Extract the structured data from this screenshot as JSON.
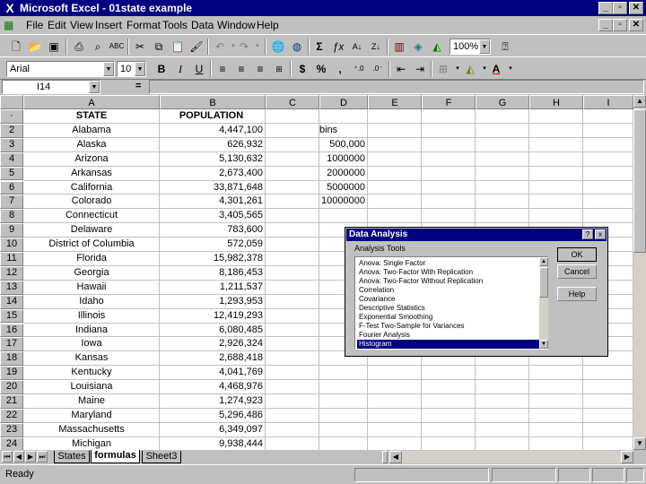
{
  "window": {
    "title": "Microsoft Excel - 01state example"
  },
  "menu": [
    "File",
    "Edit",
    "View",
    "Insert",
    "Format",
    "Tools",
    "Data",
    "Window",
    "Help"
  ],
  "toolbar": {
    "zoom": "100%"
  },
  "format_toolbar": {
    "font": "Arial",
    "size": "10",
    "bold": "B",
    "italic": "I",
    "underline": "U",
    "currency": "$",
    "percent": "%",
    "comma": ","
  },
  "formula_bar": {
    "name_box": "I14",
    "equals": "="
  },
  "columns": [
    "A",
    "B",
    "C",
    "D",
    "E",
    "F",
    "G",
    "H",
    "I"
  ],
  "headers": {
    "state": "STATE",
    "population": "POPULATION"
  },
  "rows": [
    {
      "n": "2",
      "state": "Alabama",
      "pop": "4,447,100",
      "d": "bins"
    },
    {
      "n": "3",
      "state": "Alaska",
      "pop": "626,932",
      "d": "500,000"
    },
    {
      "n": "4",
      "state": "Arizona",
      "pop": "5,130,632",
      "d": "1000000"
    },
    {
      "n": "5",
      "state": "Arkansas",
      "pop": "2,673,400",
      "d": "2000000"
    },
    {
      "n": "6",
      "state": "California",
      "pop": "33,871,648",
      "d": "5000000"
    },
    {
      "n": "7",
      "state": "Colorado",
      "pop": "4,301,261",
      "d": "10000000"
    },
    {
      "n": "8",
      "state": "Connecticut",
      "pop": "3,405,565",
      "d": ""
    },
    {
      "n": "9",
      "state": "Delaware",
      "pop": "783,600",
      "d": ""
    },
    {
      "n": "10",
      "state": "District of Columbia",
      "pop": "572,059",
      "d": ""
    },
    {
      "n": "11",
      "state": "Florida",
      "pop": "15,982,378",
      "d": ""
    },
    {
      "n": "12",
      "state": "Georgia",
      "pop": "8,186,453",
      "d": ""
    },
    {
      "n": "13",
      "state": "Hawaii",
      "pop": "1,211,537",
      "d": ""
    },
    {
      "n": "14",
      "state": "Idaho",
      "pop": "1,293,953",
      "d": ""
    },
    {
      "n": "15",
      "state": "Illinois",
      "pop": "12,419,293",
      "d": ""
    },
    {
      "n": "16",
      "state": "Indiana",
      "pop": "6,080,485",
      "d": ""
    },
    {
      "n": "17",
      "state": "Iowa",
      "pop": "2,926,324",
      "d": ""
    },
    {
      "n": "18",
      "state": "Kansas",
      "pop": "2,688,418",
      "d": ""
    },
    {
      "n": "19",
      "state": "Kentucky",
      "pop": "4,041,769",
      "d": ""
    },
    {
      "n": "20",
      "state": "Louisiana",
      "pop": "4,468,976",
      "d": ""
    },
    {
      "n": "21",
      "state": "Maine",
      "pop": "1,274,923",
      "d": ""
    },
    {
      "n": "22",
      "state": "Maryland",
      "pop": "5,296,486",
      "d": ""
    },
    {
      "n": "23",
      "state": "Massachusetts",
      "pop": "6,349,097",
      "d": ""
    },
    {
      "n": "24",
      "state": "Michigan",
      "pop": "9,938,444",
      "d": ""
    }
  ],
  "sheet_tabs": [
    "States",
    "formulas",
    "Sheet3"
  ],
  "status": "Ready",
  "dialog": {
    "title": "Data Analysis",
    "help_glyph": "?",
    "close_glyph": "x",
    "group_label": "Analysis Tools",
    "tools": [
      "Anova: Single Factor",
      "Anova: Two-Factor With Replication",
      "Anova: Two-Factor Without Replication",
      "Correlation",
      "Covariance",
      "Descriptive Statistics",
      "Exponential Smoothing",
      "F-Test Two-Sample for Variances",
      "Fourier Analysis",
      "Histogram"
    ],
    "selected_index": 9,
    "ok": "OK",
    "cancel": "Cancel",
    "help": "Help"
  }
}
